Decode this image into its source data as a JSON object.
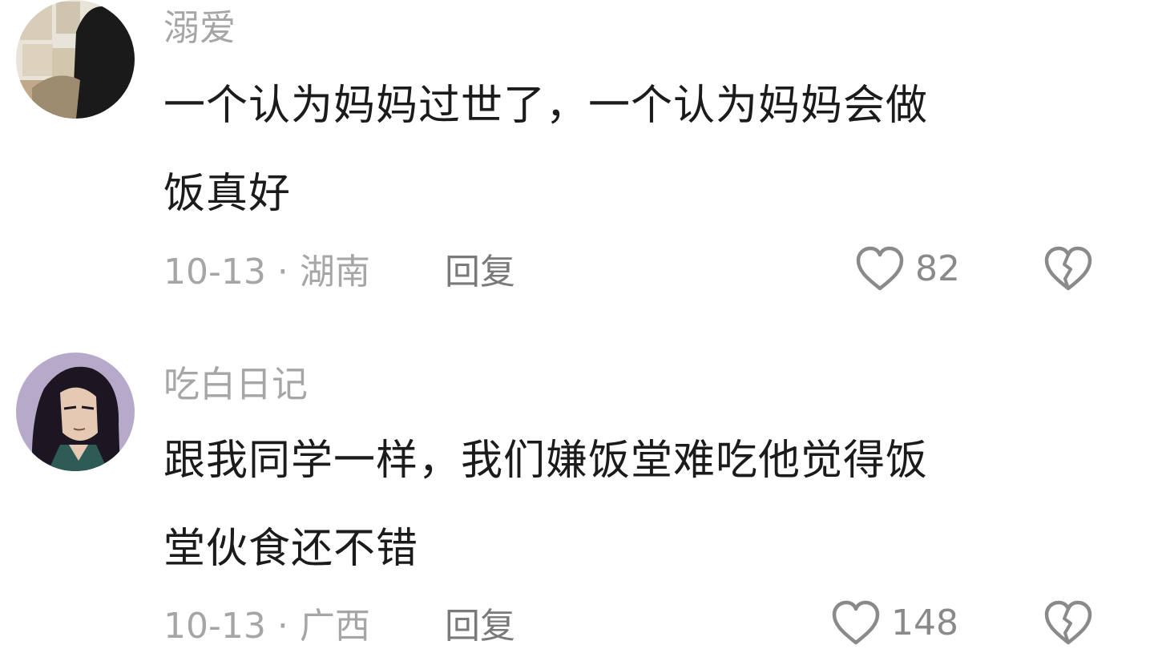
{
  "comments": [
    {
      "username": "溺爱",
      "text_line1": "一个认为妈妈过世了，一个认为妈妈会做",
      "text_line2": "饭真好",
      "date": "10-13",
      "location": "湖南",
      "reply_label": "回复",
      "likes": "82"
    },
    {
      "username": "吃白日记",
      "text_line1": "跟我同学一样，我们嫌饭堂难吃他觉得饭",
      "text_line2": "堂伙食还不错",
      "date": "10-13",
      "location": "广西",
      "reply_label": "回复",
      "likes": "148"
    }
  ],
  "meta_separator": " · ",
  "icons": {
    "like": "heart-outline-icon",
    "dislike": "broken-heart-outline-icon"
  },
  "colors": {
    "username": "#a6a6a6",
    "text": "#1b1b1b",
    "meta": "#a6a6a6",
    "icon": "#8a8a8a"
  }
}
